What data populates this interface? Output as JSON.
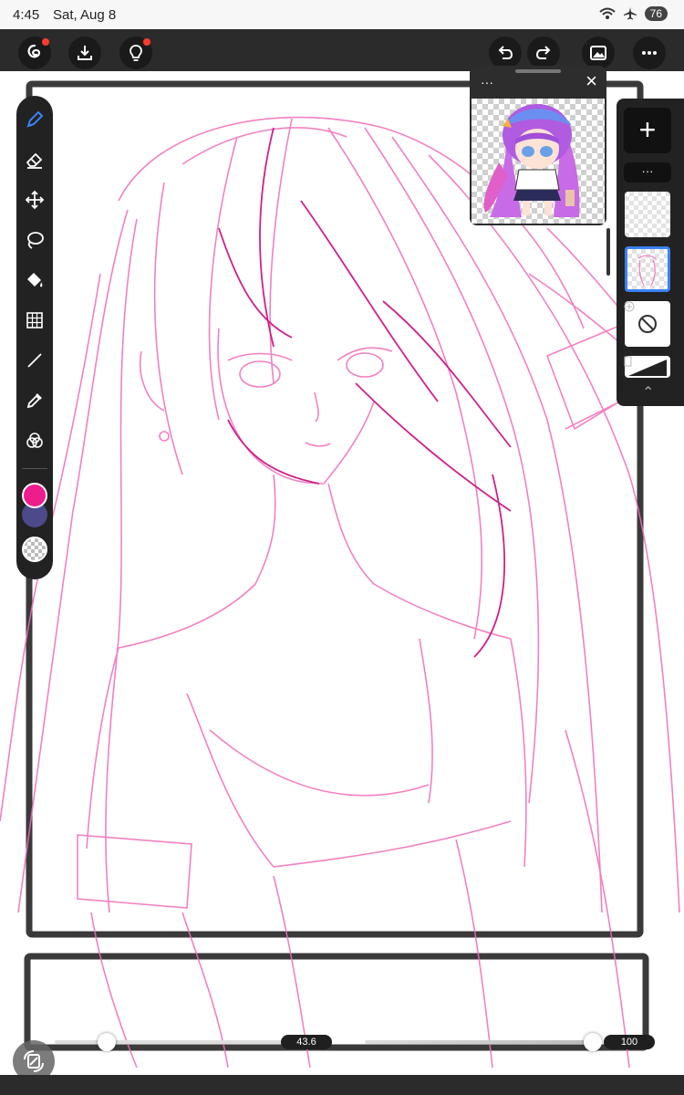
{
  "status": {
    "time": "4:45",
    "date": "Sat, Aug 8",
    "battery": "76"
  },
  "toolbar_top": {
    "left": [
      {
        "icon": "app-logo-icon",
        "badge": true
      },
      {
        "icon": "download-icon",
        "badge": false
      },
      {
        "icon": "lightbulb-icon",
        "badge": true
      }
    ],
    "right": [
      "undo-icon",
      "redo-icon",
      "gallery-icon",
      "more-icon"
    ]
  },
  "tools": [
    "pen",
    "eraser",
    "move",
    "lasso",
    "fill",
    "transform",
    "line",
    "eyedropper",
    "blend"
  ],
  "colors": {
    "primary": "#ee1c8c",
    "secondary": "#4c4a8a",
    "accent_ui": "#3b82f6",
    "sketch": "#f06bb7"
  },
  "reference": {
    "menu_label": "···",
    "close_label": "×"
  },
  "layers_panel": {
    "add_label": "+",
    "more_label": "···",
    "collapse_label": "⌃"
  },
  "sliders": {
    "size_value": "43.6",
    "size_fraction": 0.22,
    "opacity_value": "100",
    "opacity_fraction": 1.0
  }
}
